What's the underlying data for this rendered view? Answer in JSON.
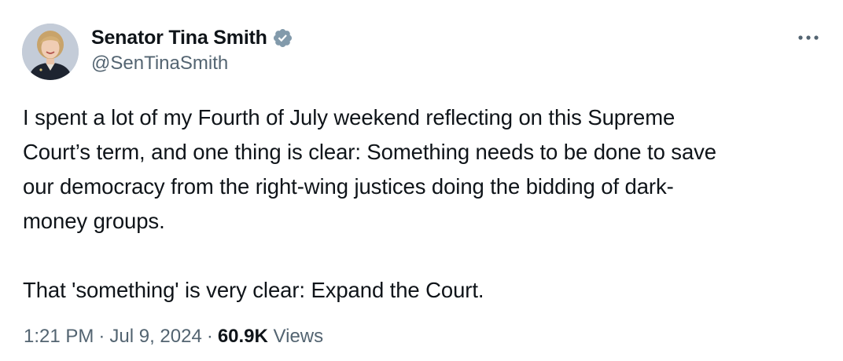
{
  "author": {
    "display_name": "Senator Tina Smith",
    "handle": "@SenTinaSmith",
    "verified_icon": "verified-badge-icon",
    "verified_color": "#829aab"
  },
  "more_icon": "more-horizontal-icon",
  "tweet": {
    "text": "I spent a lot of my Fourth of July weekend reflecting on this Supreme\nCourt’s term, and one thing is clear: Something needs to be done to save\nour democracy from the right-wing justices doing the bidding of dark-\nmoney groups.\n\nThat 'something' is very clear: Expand the Court."
  },
  "meta": {
    "time": "1:21 PM",
    "separator": "·",
    "date": "Jul 9, 2024",
    "views_count": "60.9K",
    "views_label": "Views"
  }
}
